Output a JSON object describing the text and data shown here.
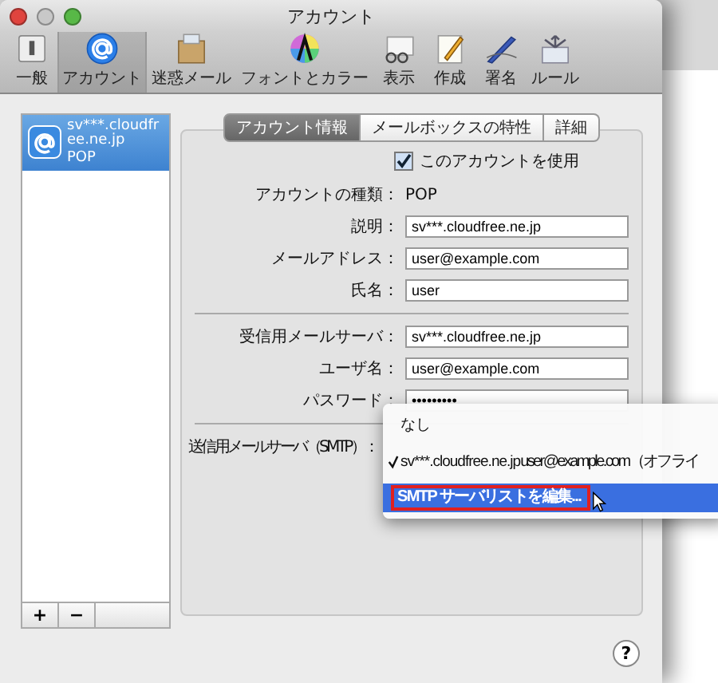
{
  "window": {
    "title": "アカウント"
  },
  "toolbar": [
    {
      "label": "一般",
      "selected": false
    },
    {
      "label": "アカウント",
      "selected": true
    },
    {
      "label": "迷惑メール",
      "selected": false
    },
    {
      "label": "フォントとカラー",
      "selected": false
    },
    {
      "label": "表示",
      "selected": false
    },
    {
      "label": "作成",
      "selected": false
    },
    {
      "label": "署名",
      "selected": false
    },
    {
      "label": "ルール",
      "selected": false
    }
  ],
  "accounts": [
    {
      "name": "sv***.cloudfree.ne.jp",
      "type": "POP",
      "selected": true
    }
  ],
  "list_buttons": [
    "+",
    "−"
  ],
  "tabs": [
    {
      "label": "アカウント情報",
      "selected": true
    },
    {
      "label": "メールボックスの特性",
      "selected": false
    },
    {
      "label": "詳細",
      "selected": false
    }
  ],
  "use_account": {
    "label": "このアカウントを使用",
    "checked": true
  },
  "sections": [
    [
      {
        "kind": "static",
        "label": "アカウントの種類：",
        "value": "POP"
      },
      {
        "kind": "input",
        "label": "説明：",
        "value": "sv***.cloudfree.ne.jp"
      },
      {
        "kind": "input",
        "label": "メールアドレス：",
        "value": "user@example.com"
      },
      {
        "kind": "input",
        "label": "氏名：",
        "value": "user"
      }
    ],
    [
      {
        "kind": "input",
        "label": "受信用メールサーバ：",
        "value": "sv***.cloudfree.ne.jp"
      },
      {
        "kind": "input",
        "label": "ユーザ名：",
        "value": "user@example.com"
      },
      {
        "kind": "input",
        "label": "パスワード：",
        "value": "•••••••••"
      }
    ],
    [
      {
        "kind": "label",
        "label": "送信用メールサーバ（SMTP）："
      }
    ]
  ],
  "smtp_menu": [
    {
      "server": "なし",
      "checked": false,
      "selected": false,
      "annotated": false
    },
    {
      "server": "sv***.cloudfree.ne.jp",
      "user": "user@example.com（オフライ",
      "checked": true,
      "selected": false,
      "annotated": false
    },
    {
      "server": "SMTP サーバリストを編集...",
      "checked": false,
      "selected": true,
      "annotated": true
    }
  ],
  "help": "?"
}
